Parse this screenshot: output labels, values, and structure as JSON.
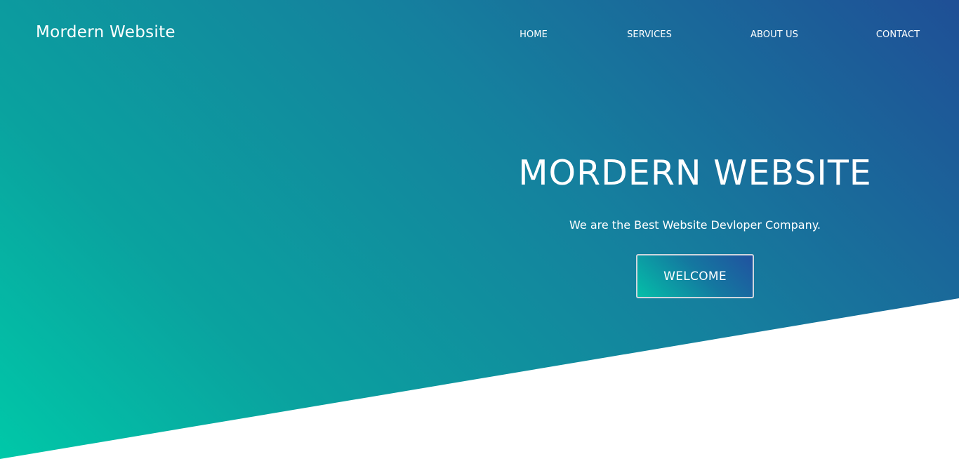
{
  "brand": {
    "logo_text": "Mordern Website"
  },
  "nav": {
    "items": [
      {
        "label": "HOME"
      },
      {
        "label": "SERVICES"
      },
      {
        "label": "ABOUT US"
      },
      {
        "label": "CONTACT"
      }
    ]
  },
  "hero": {
    "headline": "MORDERN WEBSITE",
    "tagline": "We are the Best Website Devloper Company.",
    "cta_label": "WELCOME"
  },
  "colors": {
    "gradient_start": "#00c8a8",
    "gradient_end": "#1f4f96",
    "text": "#ffffff",
    "background": "#ffffff"
  }
}
